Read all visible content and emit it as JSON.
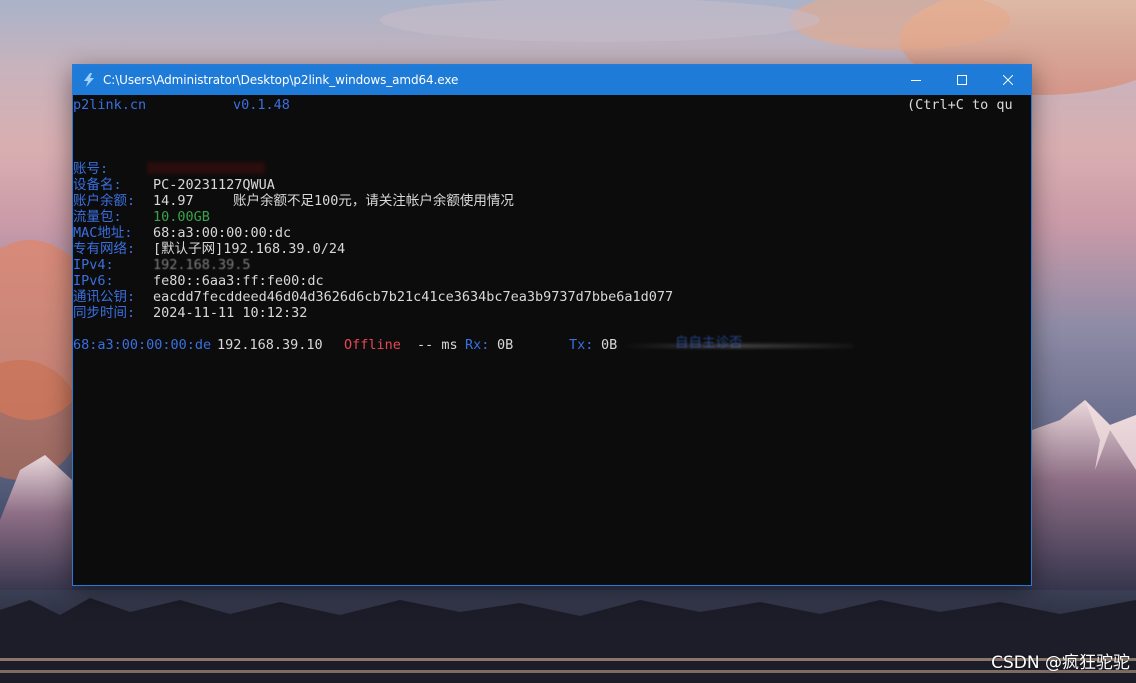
{
  "window": {
    "title": "C:\\Users\\Administrator\\Desktop\\p2link_windows_amd64.exe",
    "controls": [
      "minimize",
      "maximize",
      "close"
    ]
  },
  "console": {
    "header": {
      "site": "p2link.cn",
      "version": "v0.1.48",
      "hint": "(Ctrl+C to qu"
    },
    "fields": {
      "account": {
        "label": "账号:",
        "value": ""
      },
      "device": {
        "label": "设备名:",
        "value": "PC-20231127QWUA"
      },
      "balance": {
        "label": "账户余额:",
        "value": "14.97",
        "warning": "账户余额不足100元，请关注帐户余额使用情况"
      },
      "traffic": {
        "label": "流量包:",
        "value": "10.00GB"
      },
      "mac": {
        "label": "MAC地址:",
        "value": "68:a3:00:00:00:dc"
      },
      "network": {
        "label": "专有网络:",
        "value": "[默认子网]192.168.39.0/24"
      },
      "ipv4": {
        "label": "IPv4:",
        "value": "192.168.39.5"
      },
      "ipv6": {
        "label": "IPv6:",
        "value": "fe80::6aa3:ff:fe00:dc"
      },
      "pubkey": {
        "label": "通讯公钥:",
        "value": "eacdd7fecddeed46d04d3626d6cb7b21c41ce3634bc7ea3b9737d7bbe6a1d077"
      },
      "sync": {
        "label": "同步时间:",
        "value": "2024-11-11 10:12:32"
      }
    },
    "peer": {
      "mac": "68:a3:00:00:00:de",
      "ip": "192.168.39.10",
      "status": "Offline",
      "latency": "-- ms",
      "rx_label": "Rx:",
      "rx_value": "0B",
      "tx_label": "Tx:",
      "tx_value": "0B",
      "note": "自自主诊否"
    }
  },
  "desktop": {
    "watermark": "CSDN @疯狂驼驼"
  },
  "colors": {
    "titlebar": "#1e7bd8",
    "console_bg": "#0c0c0c",
    "label_blue": "#3a6fe0",
    "text": "#d8d8d8",
    "green": "#3aa34a",
    "offline_red": "#e74856"
  }
}
